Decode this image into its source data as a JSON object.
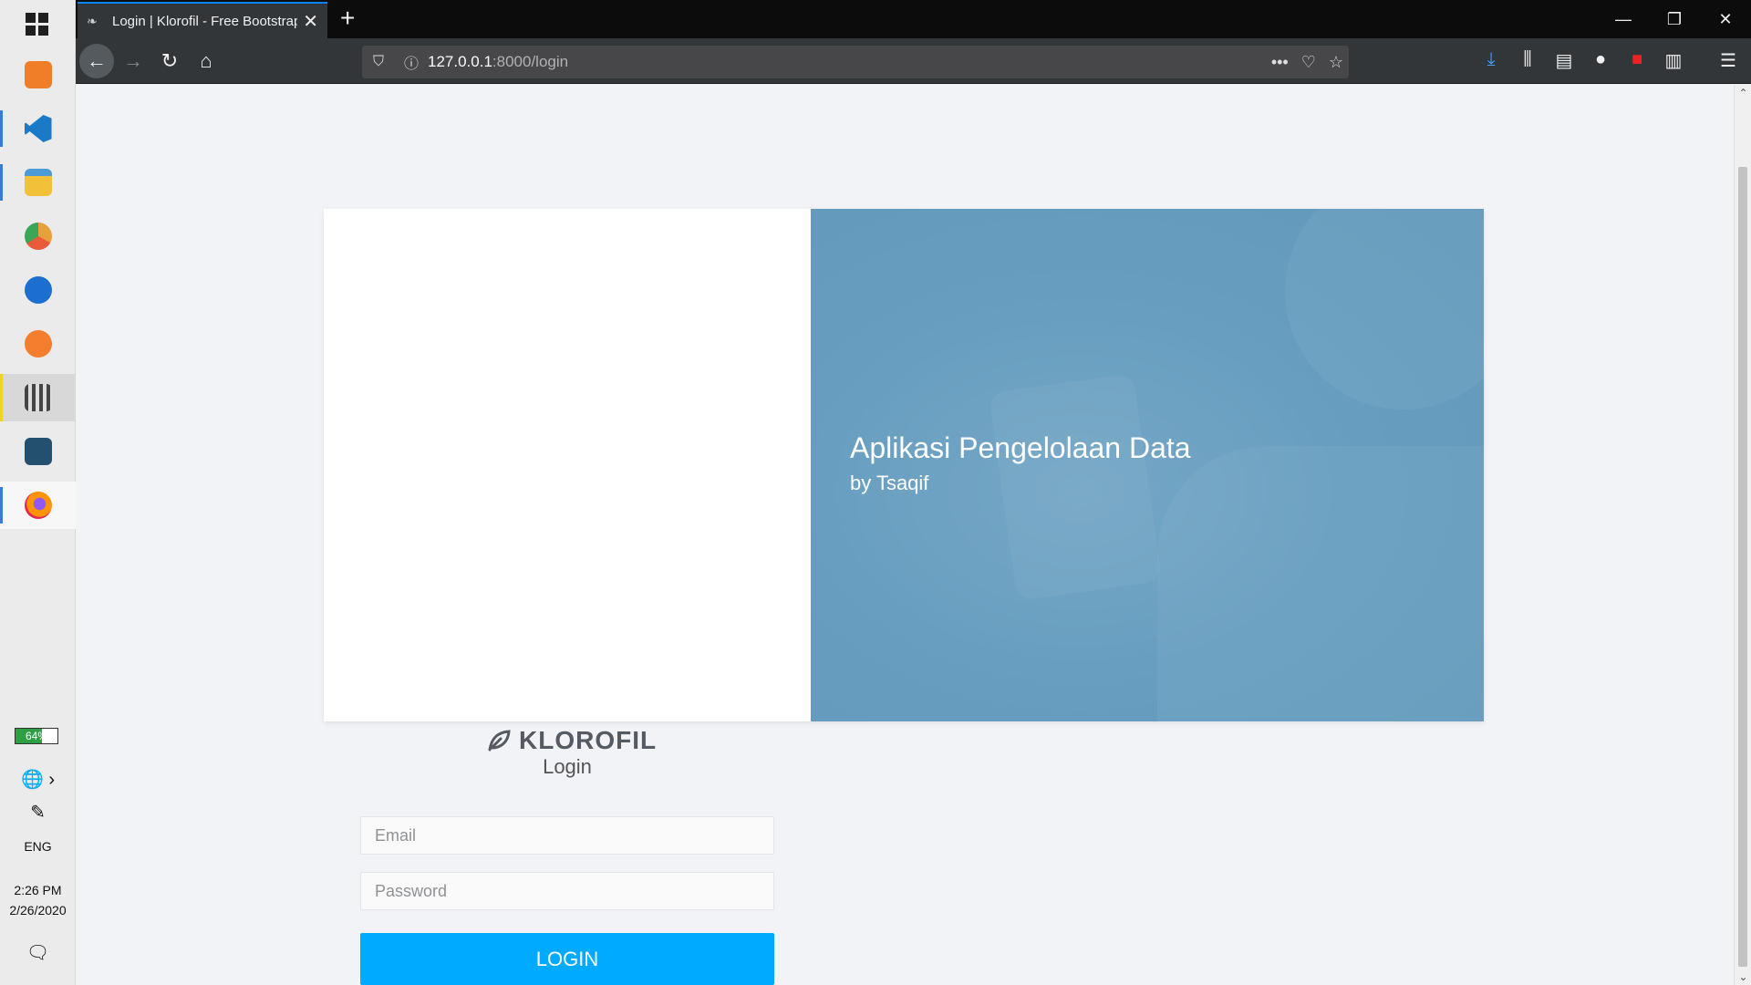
{
  "taskbar": {
    "apps": [
      {
        "name": "xampp",
        "color": "#f07d27"
      },
      {
        "name": "vscode",
        "color": "#1a7ac8"
      },
      {
        "name": "file-explorer",
        "color": "#f3c03a"
      },
      {
        "name": "chrome-canary",
        "color": "#e8a13a"
      },
      {
        "name": "maps-pin",
        "color": "#1c6fd0"
      },
      {
        "name": "sublime",
        "color": "#f57e2e"
      },
      {
        "name": "clapperboard",
        "color": "#555555"
      },
      {
        "name": "mysql-workbench",
        "color": "#23506f"
      },
      {
        "name": "firefox",
        "color": "#e66033"
      }
    ],
    "battery_label": "64%",
    "battery_level": 0.64,
    "language": "ENG",
    "time": "2:26 PM",
    "date": "2/26/2020",
    "notification_count": "1"
  },
  "browser": {
    "tab_title": "Login | Klorofil - Free Bootstrap",
    "url_host": "127.0.0.1",
    "url_path": ":8000/login",
    "new_tab_glyph": "+",
    "tab_close_glyph": "✕"
  },
  "page": {
    "hero_title": "Aplikasi Pengelolaan Data",
    "hero_subtitle": "by Tsaqif",
    "logo_text": "KLOROFIL",
    "login_heading": "Login",
    "email_placeholder": "Email",
    "password_placeholder": "Password",
    "login_button": "LOGIN",
    "accent_color": "#00aaff"
  }
}
